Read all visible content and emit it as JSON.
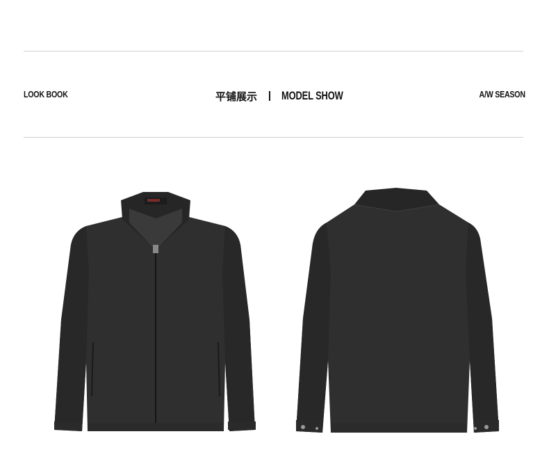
{
  "header": {
    "left_label": "LOOK BOOK",
    "center_cn": "平铺展示",
    "center_en": "MODEL SHOW",
    "right_label": "A/W SEASON"
  },
  "colors": {
    "garment": "#2f2f2f",
    "garment_dark": "#232323",
    "rule": "#cfcfcf",
    "text": "#111111"
  },
  "images": {
    "front": "jacket-front",
    "back": "jacket-back"
  }
}
